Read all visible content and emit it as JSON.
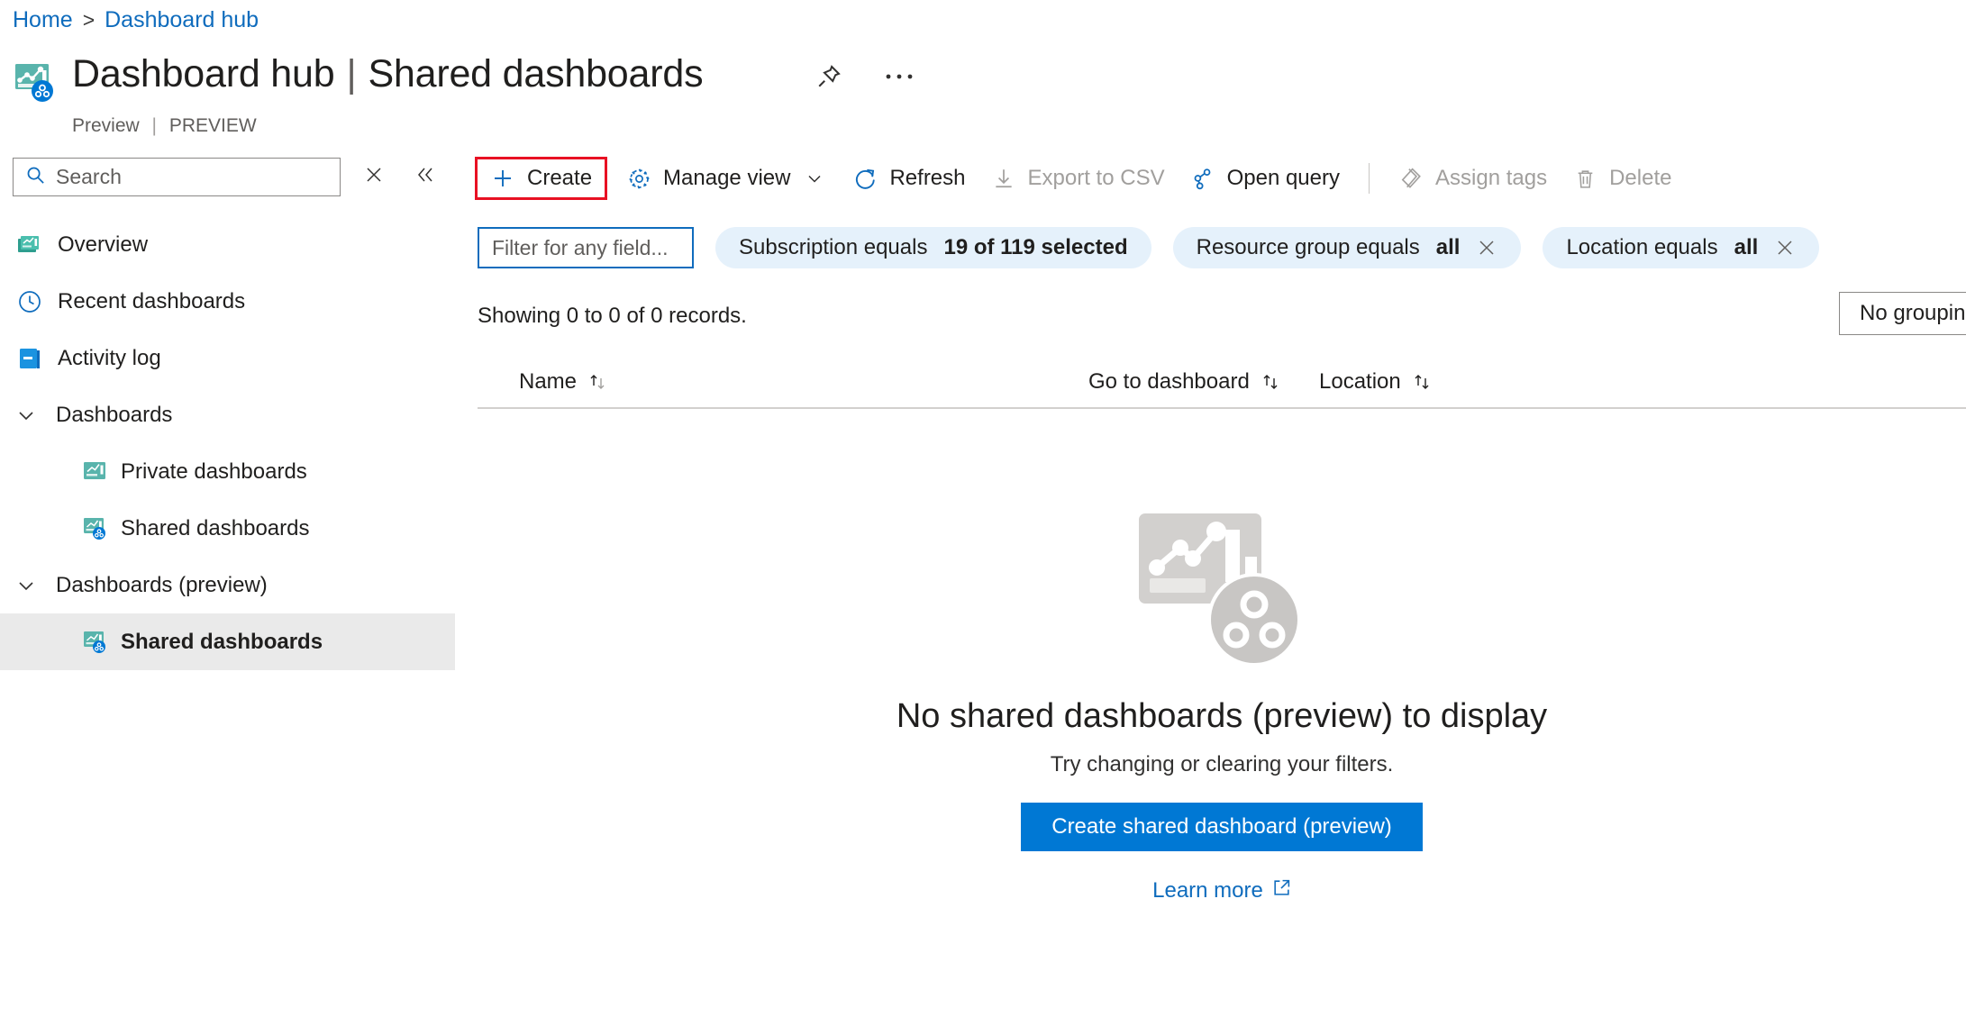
{
  "breadcrumb": {
    "home": "Home",
    "separator": ">",
    "current": "Dashboard hub"
  },
  "header": {
    "title": "Dashboard hub",
    "title_separator": "|",
    "subtitle_page": "Shared dashboards",
    "status_left": "Preview",
    "status_sep": "|",
    "status_right": "PREVIEW",
    "pin_icon": "pin-icon",
    "more_icon": "ellipsis-icon",
    "resource_icon": "shared-dashboard-icon"
  },
  "sidebar": {
    "search": {
      "placeholder": "Search",
      "icon": "search-icon",
      "clear_icon": "close-icon",
      "collapse_icon": "double-chevron-left-icon"
    },
    "items": [
      {
        "label": "Overview",
        "icon": "dashboards-icon",
        "type": "link",
        "selected": false
      },
      {
        "label": "Recent dashboards",
        "icon": "clock-icon",
        "type": "link",
        "selected": false
      },
      {
        "label": "Activity log",
        "icon": "activity-log-icon",
        "type": "link",
        "selected": false
      },
      {
        "label": "Dashboards",
        "icon": "chevron-down-icon",
        "type": "group",
        "selected": false
      },
      {
        "label": "Private dashboards",
        "icon": "private-dashboard-icon",
        "type": "child",
        "selected": false
      },
      {
        "label": "Shared dashboards",
        "icon": "shared-dashboard-icon",
        "type": "child",
        "selected": false
      },
      {
        "label": "Dashboards (preview)",
        "icon": "chevron-down-icon",
        "type": "group",
        "selected": false
      },
      {
        "label": "Shared dashboards",
        "icon": "shared-dashboard-icon",
        "type": "child",
        "selected": true
      }
    ]
  },
  "toolbar": {
    "items": [
      {
        "label": "Create",
        "icon": "plus-icon",
        "disabled": false,
        "highlighted": true,
        "chevron": false
      },
      {
        "label": "Manage view",
        "icon": "gear-icon",
        "disabled": false,
        "highlighted": false,
        "chevron": true
      },
      {
        "label": "Refresh",
        "icon": "refresh-icon",
        "disabled": false,
        "highlighted": false,
        "chevron": false
      },
      {
        "label": "Export to CSV",
        "icon": "download-icon",
        "disabled": true,
        "highlighted": false,
        "chevron": false
      },
      {
        "label": "Open query",
        "icon": "open-query-icon",
        "disabled": false,
        "highlighted": false,
        "chevron": false
      },
      {
        "label": "Assign tags",
        "icon": "tag-icon",
        "disabled": true,
        "highlighted": false,
        "chevron": false
      },
      {
        "label": "Delete",
        "icon": "trash-icon",
        "disabled": true,
        "highlighted": false,
        "chevron": false
      }
    ],
    "separator_after_index": 4
  },
  "filters": {
    "text_filter_placeholder": "Filter for any field...",
    "chips": [
      {
        "prefix": "Subscription equals",
        "value": "19 of 119 selected",
        "removable": false
      },
      {
        "prefix": "Resource group equals",
        "value": "all",
        "removable": true
      },
      {
        "prefix": "Location equals",
        "value": "all",
        "removable": true
      }
    ]
  },
  "results": {
    "count_text": "Showing 0 to 0 of 0 records.",
    "grouping_label": "No grouping",
    "columns": [
      {
        "label": "Name",
        "sortable": true
      },
      {
        "label": "Go to dashboard",
        "sortable": true
      },
      {
        "label": "Location",
        "sortable": true
      }
    ],
    "rows": []
  },
  "empty_state": {
    "illustration": "shared-dashboard-illustration",
    "title": "No shared dashboards (preview) to display",
    "subtitle": "Try changing or clearing your filters.",
    "cta_label": "Create shared dashboard (preview)",
    "learn_more_label": "Learn more",
    "learn_more_icon": "external-link-icon"
  },
  "colors": {
    "link_blue": "#0f6cbd",
    "accent_blue": "#0078d4",
    "chip_bg": "#e5f1fb",
    "highlight_red": "#e81123",
    "selected_nav_bg": "#eaeaea",
    "disabled_text": "#a19f9d",
    "teal_icon": "#59b4ac"
  }
}
